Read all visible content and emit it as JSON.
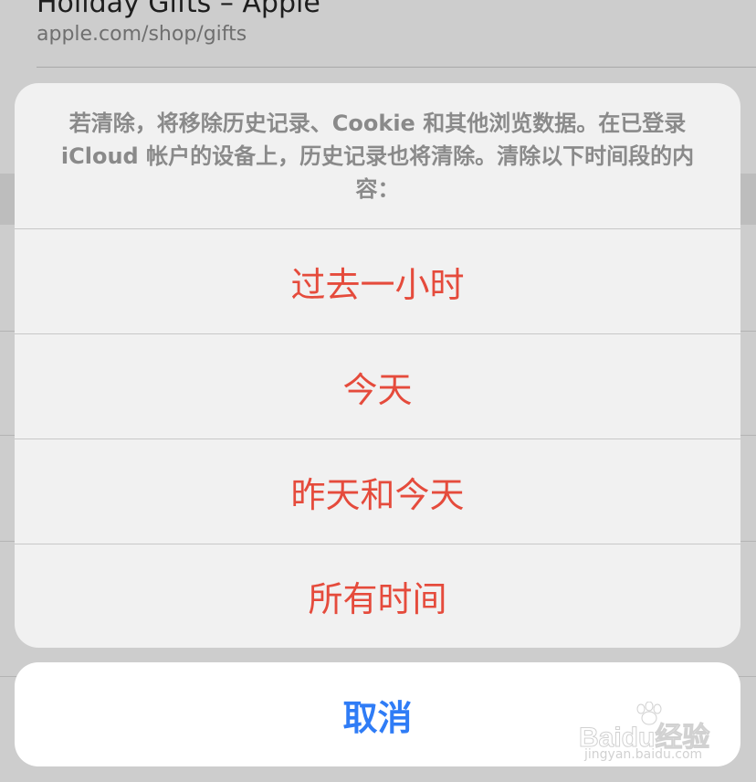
{
  "background": {
    "entry_title": "Holiday Gifts – Apple",
    "entry_url": "apple.com/shop/gifts"
  },
  "sheet": {
    "message": "若清除，将移除历史记录、Cookie 和其他浏览数据。在已登录 iCloud 帐户的设备上，历史记录也将清除。清除以下时间段的内容：",
    "options": [
      {
        "label": "过去一小时"
      },
      {
        "label": "今天"
      },
      {
        "label": "昨天和今天"
      },
      {
        "label": "所有时间"
      }
    ],
    "cancel_label": "取消"
  },
  "colors": {
    "destructive": "#e54b3c",
    "cancel": "#2f7cf6"
  },
  "watermark": {
    "text": "Baidu经验",
    "url": "jingyan.baidu.com"
  }
}
